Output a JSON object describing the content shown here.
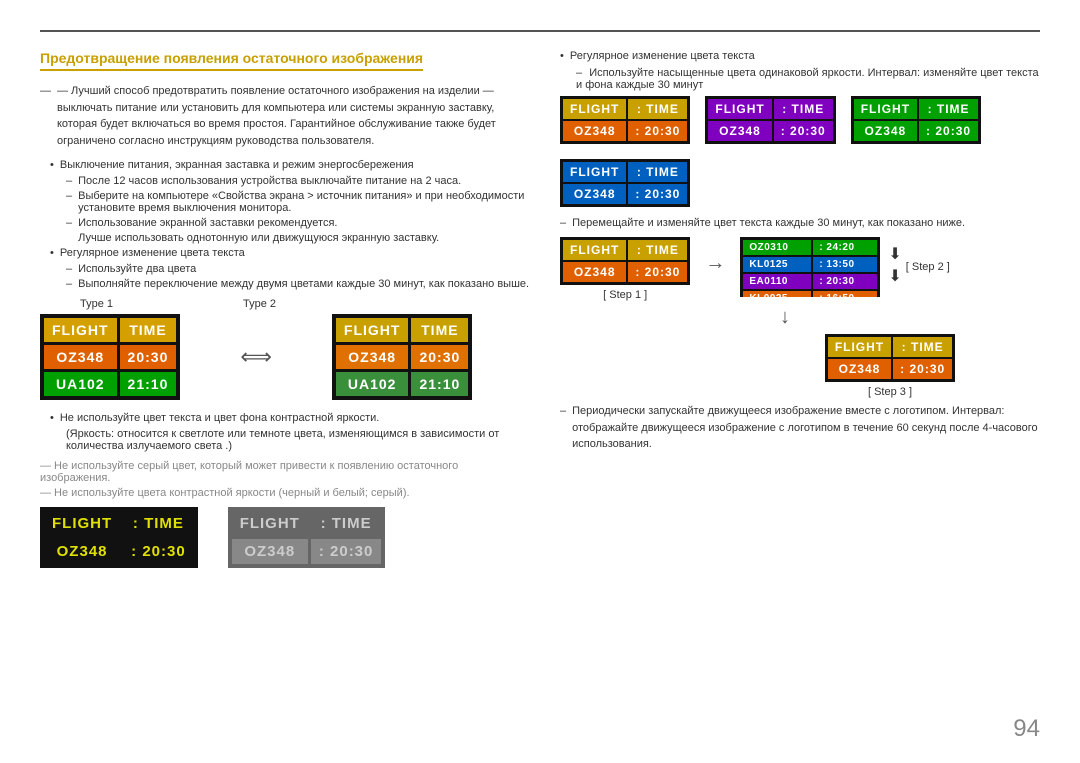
{
  "page": {
    "number": "94",
    "top_line": true
  },
  "section": {
    "title": "Предотвращение появления остаточного изображения",
    "intro_text": "— Лучший способ предотвратить появление остаточного изображения на изделии — выключать питание или установить для компьютера или системы экранную заставку, которая будет включаться во время простоя. Гарантийное обслуживание также будет ограничено согласно инструкциям руководства пользователя.",
    "bullets": [
      {
        "text": "Выключение питания, экранная заставка и режим энергосбережения",
        "sub": [
          "После 12 часов использования устройства выключайте питание на 2 часа.",
          "Выберите на компьютере «Свойства экрана > источник питания» и при необходимости установите время выключения монитора.",
          "Использование экранной заставки рекомендуется.",
          "Лучше использовать однотонную или движущуюся экранную заставку."
        ]
      },
      {
        "text": "Регулярное изменение цвета текста",
        "sub": [
          "Используйте два цвета",
          "Выполняйте переключение между двумя цветами каждые 30 минут, как показано выше."
        ]
      }
    ],
    "type_labels": [
      "Type 1",
      "Type 2"
    ],
    "type1": {
      "rows": [
        [
          "FLIGHT",
          "TIME"
        ],
        [
          "OZ348",
          "20:30"
        ],
        [
          "UA102",
          "21:10"
        ]
      ]
    },
    "type2": {
      "rows": [
        [
          "FLIGHT",
          "TIME"
        ],
        [
          "OZ348",
          "20:30"
        ],
        [
          "UA102",
          "21:10"
        ]
      ]
    },
    "contrast_warning1": "Не используйте цвет текста и цвет фона контрастной яркости.",
    "contrast_warning2": "(Яркость: относится к светлоте или темноте цвета, изменяющимся в зависимости от количества излучаемого света .)",
    "gray_warning": "— Не используйте серый цвет, который может привести к появлению остаточного изображения.",
    "contrast_warning3": "— Не используйте цвета контрастной яркости (черный и белый; серый).",
    "bottom_displays": [
      {
        "label": "black_yellow",
        "type": "contrast_bad"
      },
      {
        "label": "gray_text",
        "type": "gray_bad"
      }
    ]
  },
  "right_section": {
    "bullet1": "Регулярное изменение цвета текста",
    "sub1": "Используйте насыщенные цвета одинаковой яркости. Интервал: изменяйте цвет текста и фона каждые 30 минут",
    "color_variants": [
      {
        "header_color": "yellow_header",
        "row_color": "orange_row"
      },
      {
        "header_color": "purple_header",
        "row_color": "purple_row"
      },
      {
        "header_color": "green_header",
        "row_color": "teal_row"
      },
      {
        "header_color": "blue_header",
        "row_color": "blue_row"
      }
    ],
    "step_note": "Перемещайте и изменяйте цвет текста каждые 30 минут, как показано ниже.",
    "step1_label": "[ Step 1 ]",
    "step2_label": "[ Step 2 ]",
    "step3_label": "[ Step 3 ]",
    "bottom_note": "Периодически запускайте движущееся изображение вместе с логотипом. Интервал: отображайте движущееся изображение с логотипом в течение 60 секунд после 4-часового использования."
  },
  "flight_data": {
    "header1": "FLIGHT",
    "colon": ":",
    "header2": "TIME",
    "row1_col1": "OZ348",
    "row1_col2": "20:30",
    "row2_col1": "UA102",
    "row2_col2": "21:10"
  }
}
